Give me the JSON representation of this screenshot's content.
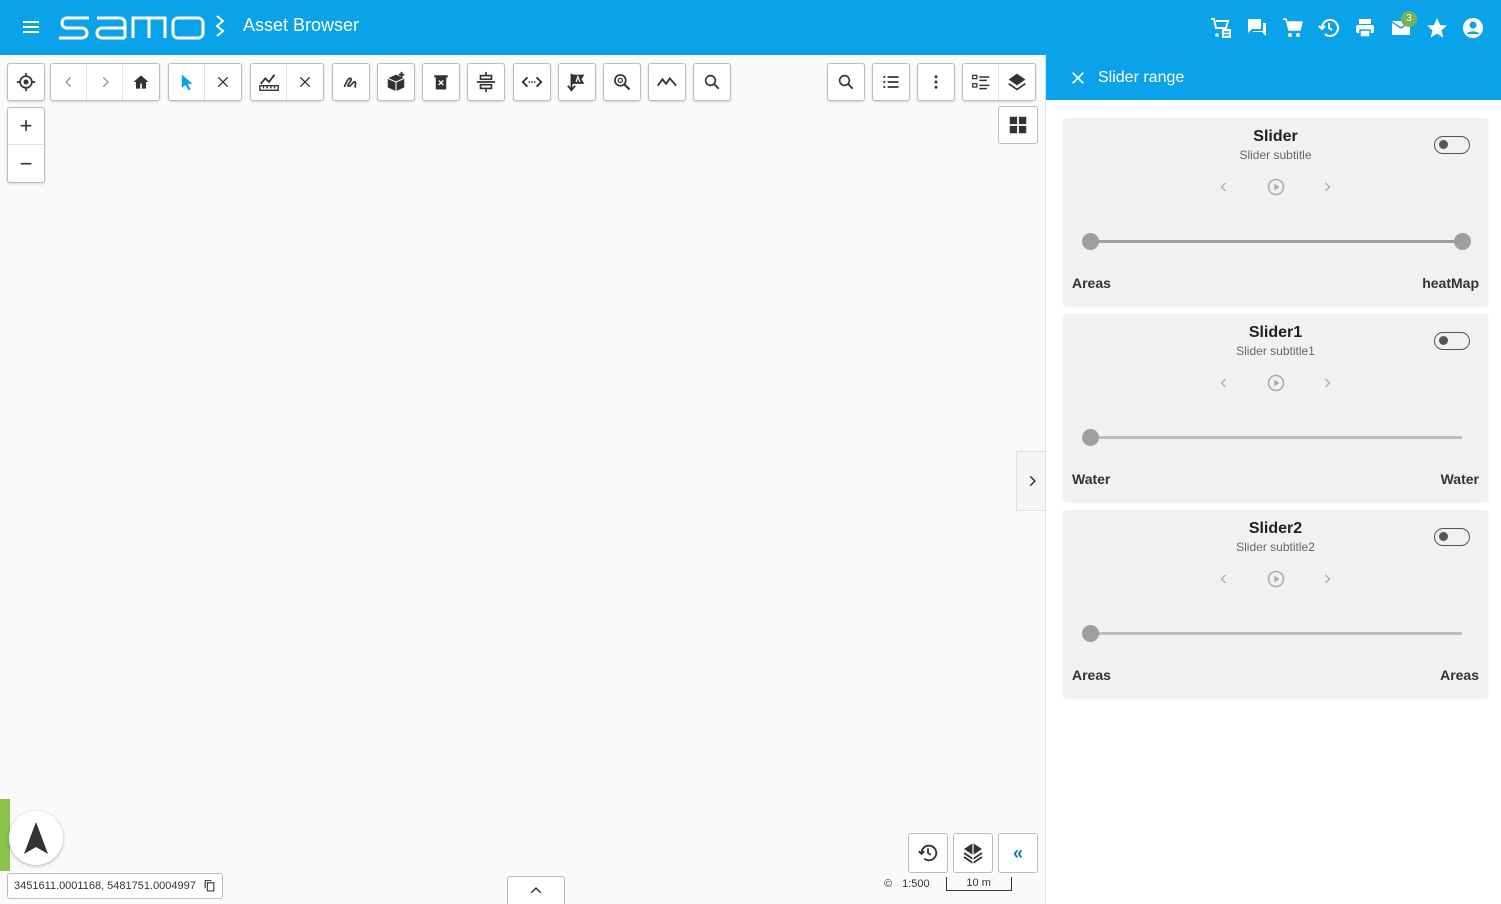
{
  "header": {
    "app_title": "Asset Browser",
    "logo_text": "samo",
    "mail_badge": "3",
    "accent_color": "#0aa3ea"
  },
  "header_icons": [
    "cart-list-icon",
    "chat-icon",
    "cart-icon",
    "history-icon",
    "print-icon",
    "mail-icon",
    "star-icon",
    "account-icon"
  ],
  "map": {
    "coordinates": "3451611.0001168, 5481751.0004997",
    "scale_label": "1:500",
    "scale_bar_label": "10 m",
    "copyright_symbol": "©"
  },
  "panel": {
    "title": "Slider range",
    "sliders": [
      {
        "title": "Slider",
        "subtitle": "Slider subtitle",
        "label_start": "Areas",
        "label_end": "heatMap",
        "range_start": 0,
        "range_end": 1
      },
      {
        "title": "Slider1",
        "subtitle": "Slider subtitle1",
        "label_start": "Water",
        "label_end": "Water",
        "range_start": 0,
        "range_end": 0
      },
      {
        "title": "Slider2",
        "subtitle": "Slider subtitle2",
        "label_start": "Areas",
        "label_end": "Areas",
        "range_start": 0,
        "range_end": 0
      }
    ]
  }
}
